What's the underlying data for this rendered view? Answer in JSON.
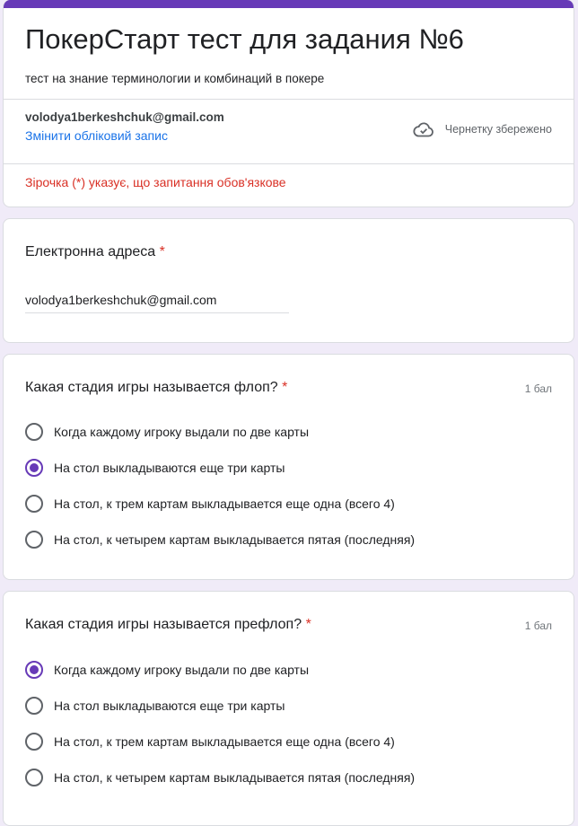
{
  "colors": {
    "accent": "#673ab7",
    "link": "#1a73e8",
    "required": "#d93025",
    "background": "#f0ebf8"
  },
  "header": {
    "title": "ПокерСтарт тест для задания №6",
    "description": "тест на знание терминологии и комбинаций в покере",
    "account_email": "volodya1berkeshchuk@gmail.com",
    "switch_account": "Змінити обліковий запис",
    "draft_status": "Чернетку збережено",
    "draft_icon": "cloud-check-icon",
    "required_note": "Зірочка (*) указує, що запитання обов'язкове"
  },
  "email_question": {
    "title": "Електронна адреса",
    "required_mark": "*",
    "value": "volodya1berkeshchuk@gmail.com"
  },
  "questions": [
    {
      "title": "Какая стадия игры называется флоп?",
      "required_mark": "*",
      "points": "1 бал",
      "selected": 1,
      "options": [
        "Когда каждому игроку выдали по две карты",
        "На стол выкладываются еще три карты",
        "На стол, к трем картам выкладывается еще одна (всего 4)",
        "На стол, к четырем картам выкладывается пятая (последняя)"
      ]
    },
    {
      "title": "Какая стадия игры называется префлоп?",
      "required_mark": "*",
      "points": "1 бал",
      "selected": 0,
      "options": [
        "Когда каждому игроку выдали по две карты",
        "На стол выкладываются еще три карты",
        "На стол, к трем картам выкладывается еще одна (всего 4)",
        "На стол, к четырем картам выкладывается пятая (последняя)"
      ]
    }
  ]
}
